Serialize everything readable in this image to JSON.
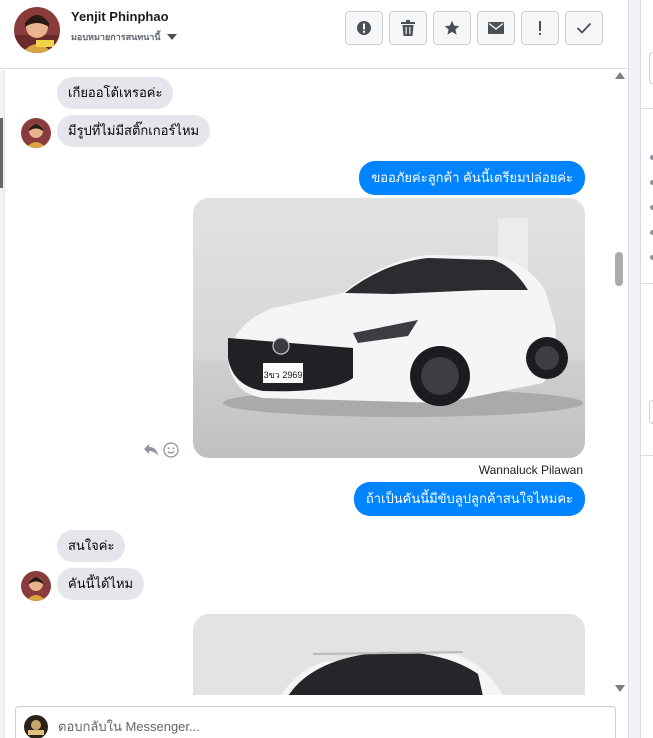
{
  "header": {
    "name": "Yenjit Phinphao",
    "subtitle": "มอบหมายการสนทนานี้"
  },
  "toolbar": {
    "buttons": [
      {
        "icon": "alert-circle-icon",
        "glyph": "!"
      },
      {
        "icon": "trash-icon"
      },
      {
        "icon": "star-icon"
      },
      {
        "icon": "envelope-icon"
      },
      {
        "icon": "exclamation-icon",
        "glyph": "!"
      },
      {
        "icon": "check-icon"
      }
    ]
  },
  "messages": [
    {
      "direction": "in",
      "text": "เกียออโต้เหรอค่ะ"
    },
    {
      "direction": "in",
      "text": "มีรูปที่ไม่มีสติ๊กเกอร์ไหม"
    },
    {
      "direction": "out",
      "text": "ขออภัยค่ะลูกค้า คันนี้เตรียมปล่อยค่ะ"
    },
    {
      "direction": "out",
      "type": "photo",
      "plate": "3ขว 2969"
    },
    {
      "sender": "Wannaluck Pilawan"
    },
    {
      "direction": "out",
      "text": "ถ้าเป็นคันนี้มีขับลูปลูกค้าสนใจไหมคะ"
    },
    {
      "direction": "in",
      "text": "สนใจค่ะ"
    },
    {
      "direction": "in",
      "text": "คันนี้ได้ไหม"
    },
    {
      "direction": "out",
      "type": "photo"
    }
  ],
  "composer": {
    "placeholder": "ตอบกลับใน Messenger..."
  },
  "colors": {
    "outgoing_bubble": "#0084ff",
    "incoming_bubble": "#e4e6eb",
    "header_border": "#dadde1"
  }
}
